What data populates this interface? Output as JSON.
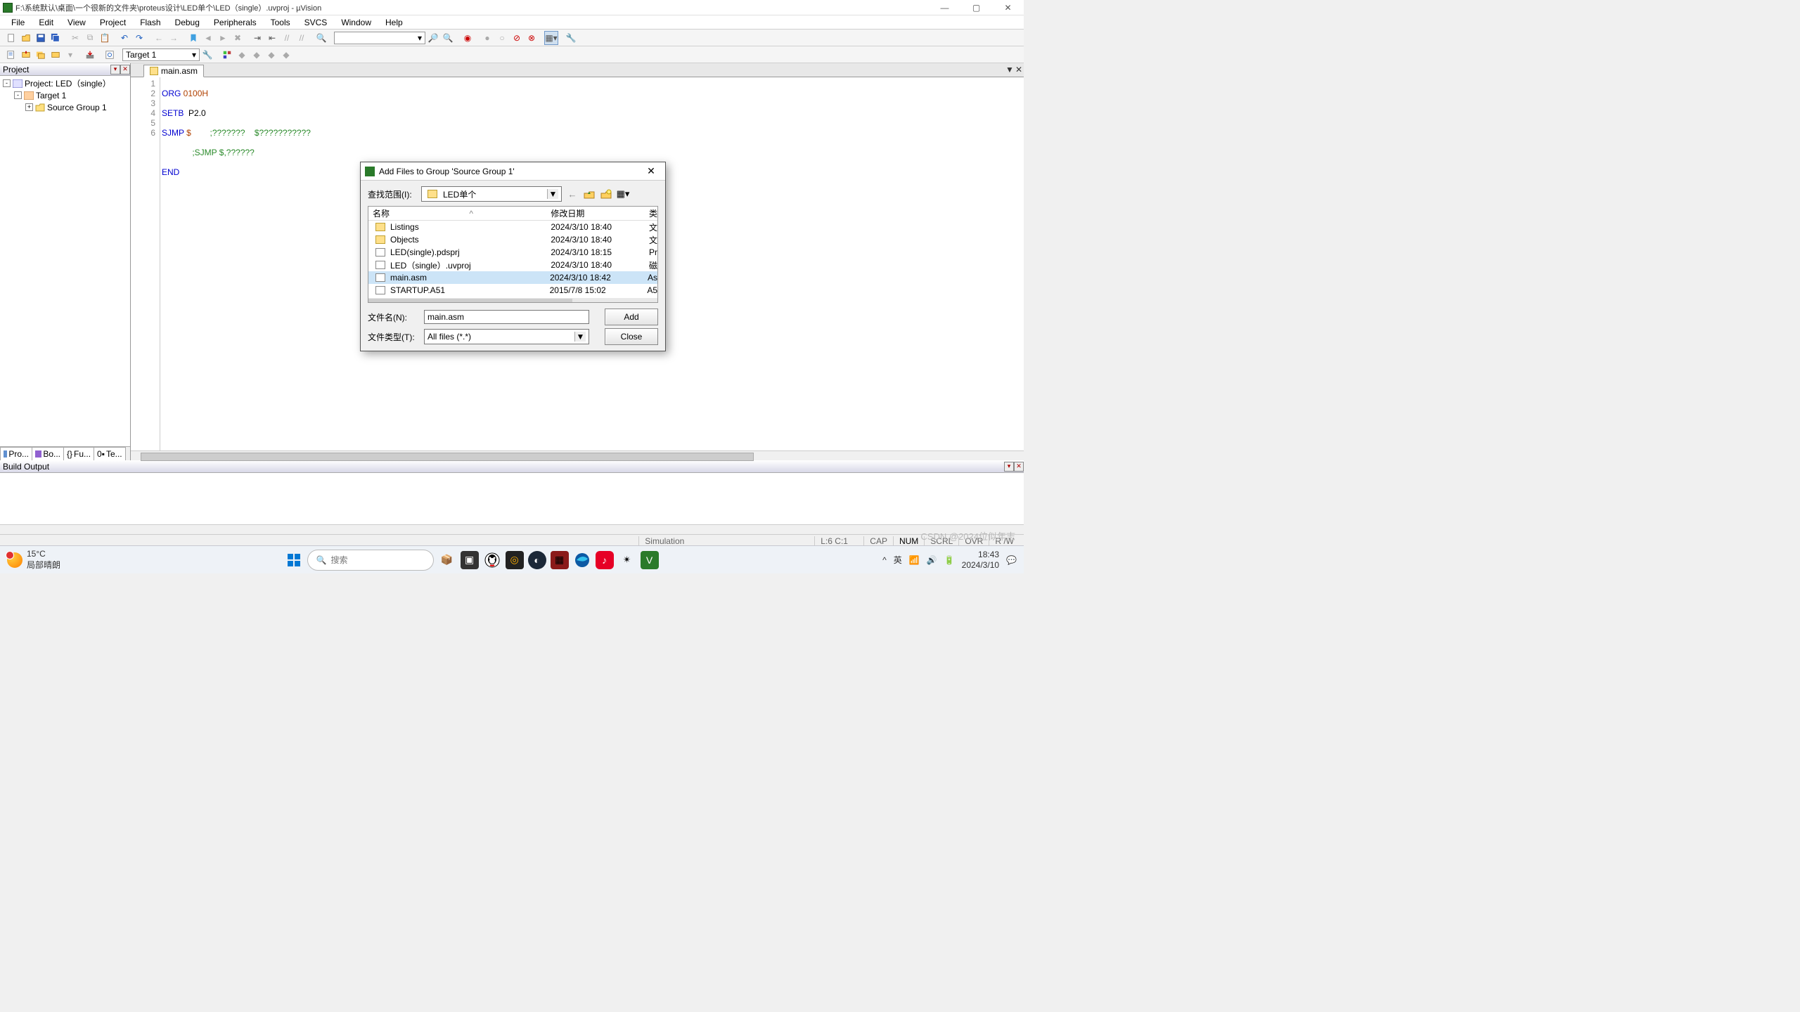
{
  "window": {
    "title": "F:\\系统默认\\桌面\\一个很新的文件夹\\proteus设计\\LED单个\\LED（single）.uvproj - µVision",
    "minimize": "—",
    "maximize": "▢",
    "close": "✕"
  },
  "menu": [
    "File",
    "Edit",
    "View",
    "Project",
    "Flash",
    "Debug",
    "Peripherals",
    "Tools",
    "SVCS",
    "Window",
    "Help"
  ],
  "toolbar2": {
    "target": "Target 1"
  },
  "project": {
    "title": "Project",
    "root": "Project: LED（single）",
    "target": "Target 1",
    "group": "Source Group 1",
    "tabs": [
      "Pro...",
      "Bo...",
      "Fu...",
      "Te..."
    ]
  },
  "editor": {
    "tab": "main.asm",
    "lines": [
      "1",
      "2",
      "3",
      "4",
      "5",
      "6"
    ],
    "code": {
      "l1a": "ORG ",
      "l1b": "0100H",
      "l2a": "SETB",
      "l2b": "  P2.0",
      "l3a": "SJMP ",
      "l3b": "$",
      "l3c": "        ;???????    $???????????",
      "l4": "             ;SJMP $,??????",
      "l5": "END"
    }
  },
  "build": {
    "title": "Build Output"
  },
  "status": {
    "sim": "Simulation",
    "pos": "L:6 C:1",
    "cap": "CAP",
    "num": "NUM",
    "scrl": "SCRL",
    "ovr": "OVR",
    "rw": "R /W"
  },
  "dialog": {
    "title": "Add Files to Group 'Source Group 1'",
    "look_in_label": "查找范围(I):",
    "look_in_value": "LED单个",
    "columns": {
      "name": "名称",
      "date": "修改日期",
      "type": "类"
    },
    "sort_arrow": "^",
    "files": [
      {
        "name": "Listings",
        "date": "2024/3/10 18:40",
        "type": "文",
        "icon": "fold"
      },
      {
        "name": "Objects",
        "date": "2024/3/10 18:40",
        "type": "文",
        "icon": "fold"
      },
      {
        "name": "LED(single).pdsprj",
        "date": "2024/3/10 18:15",
        "type": "Pr",
        "icon": "fil"
      },
      {
        "name": "LED（single）.uvproj",
        "date": "2024/3/10 18:40",
        "type": "磁",
        "icon": "fil"
      },
      {
        "name": "main.asm",
        "date": "2024/3/10 18:42",
        "type": "As",
        "icon": "fil",
        "selected": true
      },
      {
        "name": "STARTUP.A51",
        "date": "2015/7/8 15:02",
        "type": "A5",
        "icon": "fil"
      }
    ],
    "filename_label": "文件名(N):",
    "filename_value": "main.asm",
    "filetype_label": "文件类型(T):",
    "filetype_value": "All files (*.*)",
    "add": "Add",
    "close": "Close"
  },
  "taskbar": {
    "temp": "15°C",
    "weather": "局部晴朗",
    "search": "搜索",
    "ime": "英",
    "time": "18:43",
    "date": "2024/3/10"
  },
  "watermark": "CSDN @2024位似年志"
}
